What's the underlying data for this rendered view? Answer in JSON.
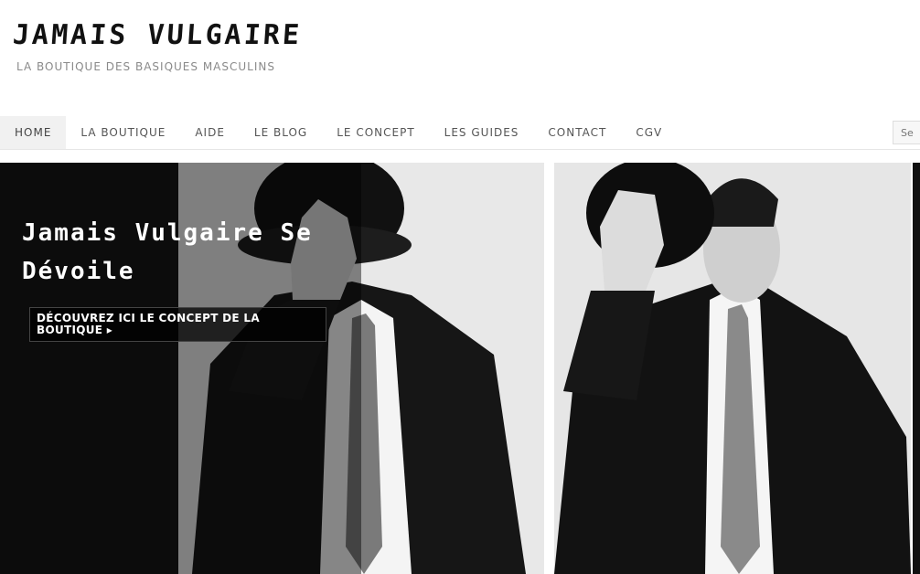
{
  "brand": {
    "title": "JAMAIS VULGAIRE",
    "tagline": "LA BOUTIQUE DES BASIQUES MASCULINS"
  },
  "nav": {
    "items": [
      {
        "label": "HOME",
        "active": true
      },
      {
        "label": "LA BOUTIQUE"
      },
      {
        "label": "AIDE"
      },
      {
        "label": "LE BLOG"
      },
      {
        "label": "LE CONCEPT"
      },
      {
        "label": "LES GUIDES"
      },
      {
        "label": "CONTACT"
      },
      {
        "label": "CGV"
      }
    ],
    "search_placeholder": "Se"
  },
  "slider": {
    "caption_title": "Jamais Vulgaire Se Dévoile",
    "caption_button": "DÉCOUVREZ ICI LE CONCEPT DE LA BOUTIQUE ▸"
  },
  "colors": {
    "background": "#ffffff",
    "nav_active_bg": "#f1f1f1",
    "nav_text": "#555555",
    "tagline": "#8a8a8a"
  }
}
